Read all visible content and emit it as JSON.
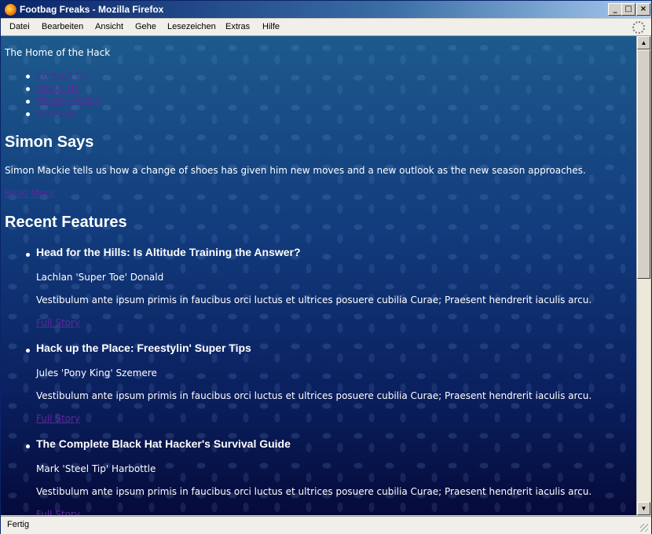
{
  "window": {
    "title": "Footbag Freaks - Mozilla Firefox",
    "buttons": {
      "minimize": "_",
      "maximize": "□",
      "close": "×"
    }
  },
  "menubar": {
    "items": [
      "Datei",
      "Bearbeiten",
      "Ansicht",
      "Gehe",
      "Lesezeichen",
      "Extras",
      "Hilfe"
    ]
  },
  "page": {
    "tagline": "The Home of the Hack",
    "nav": [
      "Contact Us",
      "About Us",
      "Privacy Policy",
      "Sitemap"
    ],
    "simon": {
      "heading": "Simon Says",
      "text": "Simon Mackie tells us how a change of shoes has given him new moves and a new outlook as the new season approaches.",
      "link": "Read More"
    },
    "features": {
      "heading": "Recent Features",
      "items": [
        {
          "title": "Head for the Hills: Is Altitude Training the Answer?",
          "author": "Lachlan 'Super Toe' Donald",
          "body": "Vestibulum ante ipsum primis in faucibus orci luctus et ultrices posuere cubilia Curae; Praesent hendrerit iaculis arcu.",
          "link": "Full Story"
        },
        {
          "title": "Hack up the Place: Freestylin' Super Tips",
          "author": "Jules 'Pony King' Szemere",
          "body": "Vestibulum ante ipsum primis in faucibus orci luctus et ultrices posuere cubilia Curae; Praesent hendrerit iaculis arcu.",
          "link": "Full Story"
        },
        {
          "title": "The Complete Black Hat Hacker's Survival Guide",
          "author": "Mark 'Steel Tip' Harbottle",
          "body": "Vestibulum ante ipsum primis in faucibus orci luctus et ultrices posuere cubilia Curae; Praesent hendrerit iaculis arcu.",
          "link": "Full Story"
        }
      ]
    }
  },
  "statusbar": {
    "text": "Fertig"
  },
  "colors": {
    "link": "#5a2a9a",
    "titlebar": "#0a246a",
    "page_background": "#0a1f5e"
  }
}
